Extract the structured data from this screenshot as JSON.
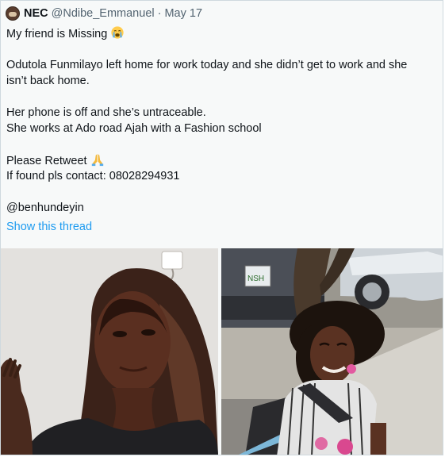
{
  "tweet": {
    "author_name": "NEC",
    "handle": "@Ndibe_Emmanuel",
    "separator": "·",
    "date": "May 17",
    "lines": {
      "l1": "My friend is Missing",
      "l2": "Odutola Funmilayo left home for work today and she didn’t get to work and she",
      "l3": "isn’t back home.",
      "l4": "Her phone is off  and she’s untraceable.",
      "l5": "She works at Ado road Ajah with a Fashion school",
      "l6": "Please Retweet",
      "l7": "If found pls contact: 08028294931",
      "l8": "@benhundeyin"
    },
    "show_thread": "Show this thread",
    "icons": {
      "crying": "loudly-crying-face-icon",
      "pray": "folded-hands-icon"
    },
    "car_plate": "NSH",
    "colors": {
      "link": "#1d9bf0",
      "secondary": "#536471",
      "border": "#cfd9de"
    }
  }
}
